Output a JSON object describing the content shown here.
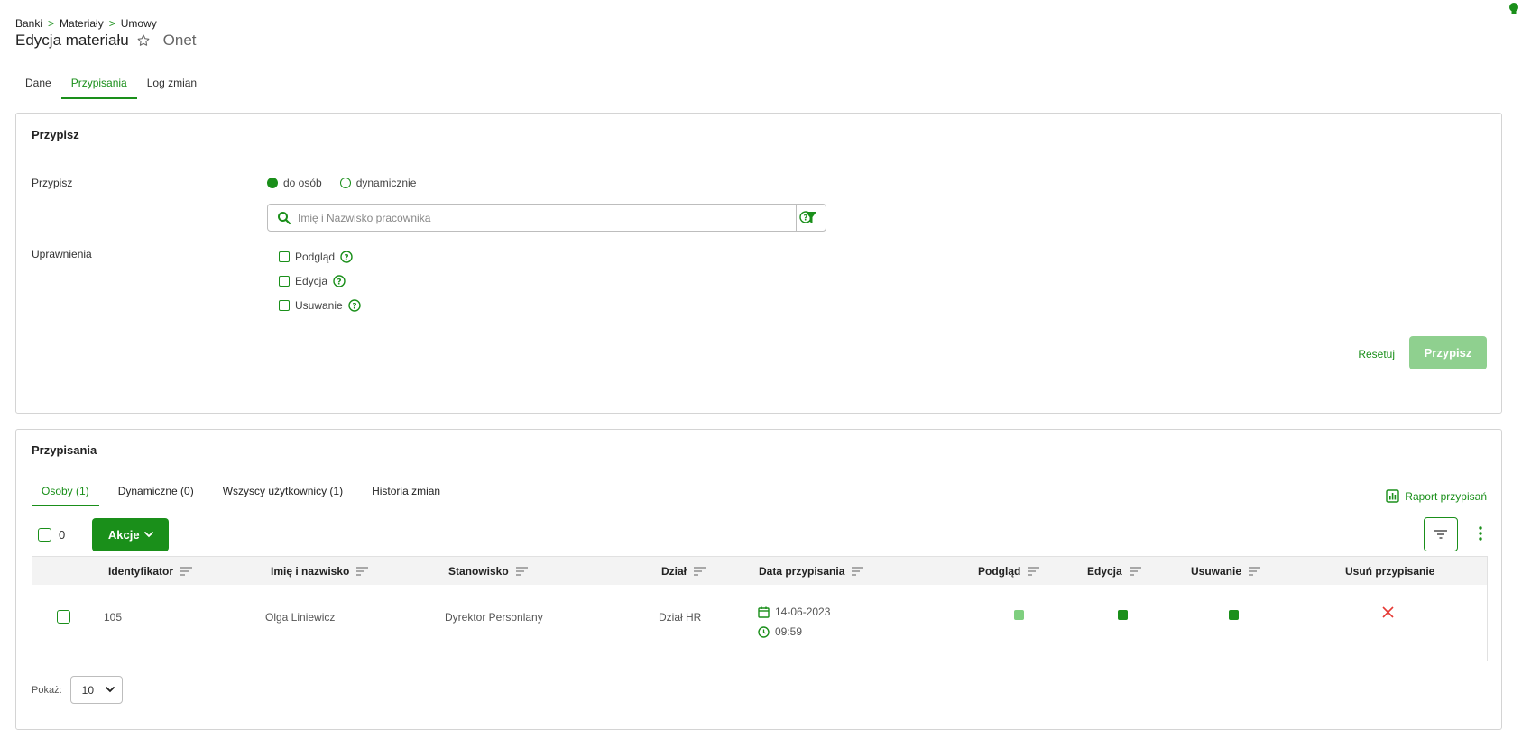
{
  "breadcrumb": [
    "Banki",
    "Materiały",
    "Umowy"
  ],
  "breadcrumb_separator": ">",
  "header": {
    "title": "Edycja materiału",
    "subtitle": "Onet"
  },
  "tabs": [
    {
      "label": "Dane",
      "active": false
    },
    {
      "label": "Przypisania",
      "active": true
    },
    {
      "label": "Log zmian",
      "active": false
    }
  ],
  "assign_panel": {
    "title": "Przypisz",
    "assign_label": "Przypisz",
    "radio_options": [
      {
        "label": "do osób",
        "checked": true
      },
      {
        "label": "dynamicznie",
        "checked": false
      }
    ],
    "search_placeholder": "Imię i Nazwisko pracownika",
    "permissions_label": "Uprawnienia",
    "permissions": [
      {
        "label": "Podgląd",
        "checked": false
      },
      {
        "label": "Edycja",
        "checked": false
      },
      {
        "label": "Usuwanie",
        "checked": false
      }
    ],
    "reset_label": "Resetuj",
    "submit_label": "Przypisz"
  },
  "assignments_panel": {
    "title": "Przypisania",
    "subtabs": [
      {
        "label": "Osoby (1)",
        "active": true
      },
      {
        "label": "Dynamiczne (0)",
        "active": false
      },
      {
        "label": "Wszyscy użytkownicy (1)",
        "active": false
      },
      {
        "label": "Historia zmian",
        "active": false
      }
    ],
    "report_label": "Raport przypisań",
    "selected_count": "0",
    "actions_label": "Akcje",
    "columns": [
      "Identyfikator",
      "Imię i nazwisko",
      "Stanowisko",
      "Dział",
      "Data przypisania",
      "Podgląd",
      "Edycja",
      "Usuwanie",
      "Usuń przypisanie"
    ],
    "rows": [
      {
        "id": "105",
        "name": "Olga Liniewicz",
        "position": "Dyrektor Personlany",
        "department": "Dział HR",
        "date": "14-06-2023",
        "time": "09:59",
        "view": "partial",
        "edit": "full",
        "delete": "full"
      }
    ],
    "page_size_label": "Pokaż:",
    "page_size_value": "10"
  },
  "colors": {
    "accent": "#1a8f1a",
    "accent_light": "#8fd08f",
    "partial_perm": "#7fcf7f",
    "full_perm": "#1a8f1a",
    "remove": "#e53935"
  }
}
